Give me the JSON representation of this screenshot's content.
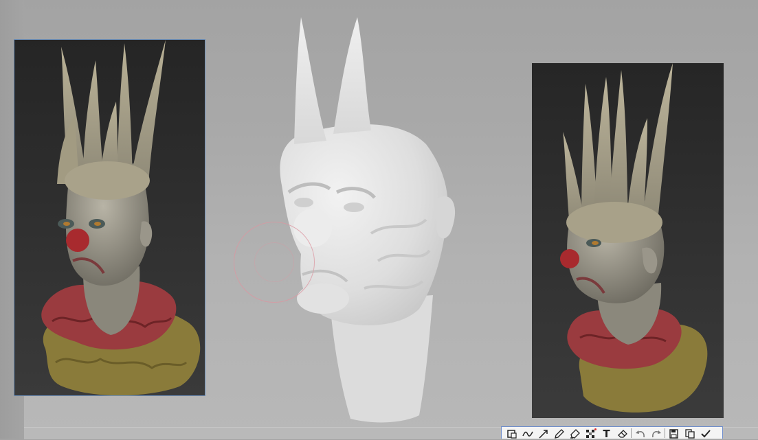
{
  "canvas": {
    "background_color": "#a9a9a9",
    "left_strip_color": "#a0a0a0"
  },
  "references": [
    {
      "name": "clown-bust-front-reference",
      "background_color": "#2a2a2a",
      "selected": true
    },
    {
      "name": "clown-bust-side-reference",
      "background_color": "#2d2d2d",
      "selected": false
    }
  ],
  "model": {
    "name": "unpainted-clown-head-sculpt",
    "color": "#e6e6e6"
  },
  "brush_cursor": {
    "color": "#dc96a0"
  },
  "colors": {
    "skin": "#9e9a8c",
    "spikes": "#b5ad92",
    "ruff_red": "#9a3b3f",
    "ruff_gold": "#8a7b3a",
    "nose": "#a82a2e",
    "toolbar_border": "#6f8ecc",
    "toolbar_bg": "#f4f4f4",
    "toolbar_dot": "#e03030"
  },
  "toolbar": {
    "tools": [
      {
        "id": "rect-select",
        "icon": "rectangle-select-icon"
      },
      {
        "id": "freehand",
        "icon": "freehand-line-icon"
      },
      {
        "id": "arrow",
        "icon": "arrow-icon"
      },
      {
        "id": "pen",
        "icon": "pen-icon"
      },
      {
        "id": "highlighter",
        "icon": "highlighter-icon"
      },
      {
        "id": "mosaic",
        "icon": "mosaic-icon"
      },
      {
        "id": "text",
        "icon": "text-icon"
      },
      {
        "id": "eraser",
        "icon": "eraser-icon"
      },
      {
        "id": "undo",
        "icon": "undo-icon"
      },
      {
        "id": "redo",
        "icon": "redo-icon"
      },
      {
        "id": "save",
        "icon": "save-icon"
      },
      {
        "id": "copy",
        "icon": "copy-icon"
      },
      {
        "id": "confirm",
        "icon": "checkmark-icon"
      }
    ],
    "text_tool_glyph": "T"
  }
}
